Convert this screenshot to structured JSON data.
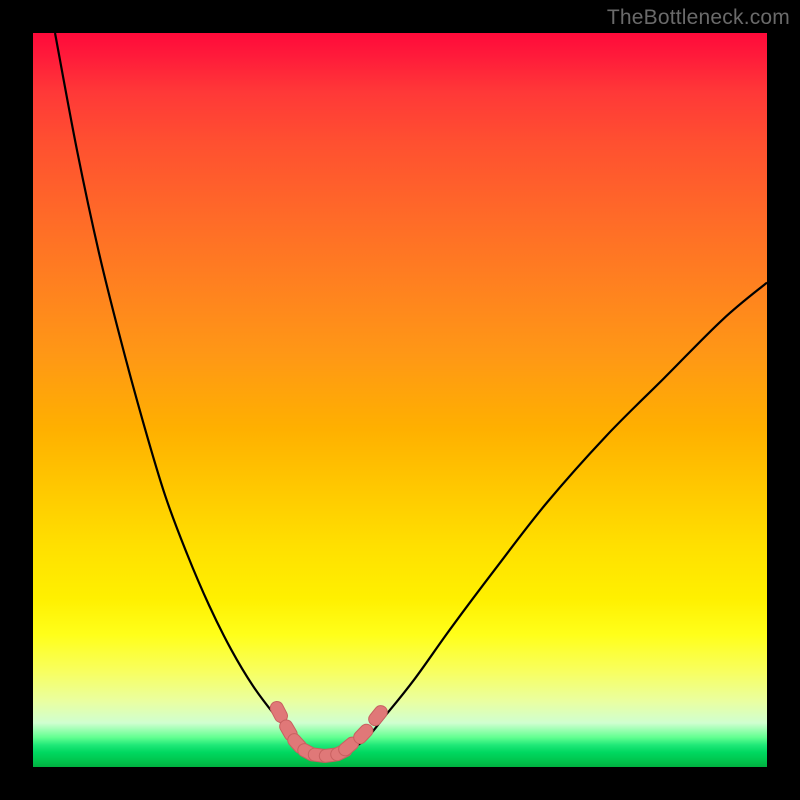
{
  "watermark": "TheBottleneck.com",
  "colors": {
    "frame": "#000000",
    "curve_stroke": "#000000",
    "marker_fill": "#e07878",
    "marker_stroke": "#c86060"
  },
  "chart_data": {
    "type": "line",
    "title": "",
    "xlabel": "",
    "ylabel": "",
    "xlim": [
      0,
      100
    ],
    "ylim": [
      0,
      100
    ],
    "series": [
      {
        "name": "left-curve",
        "x": [
          3,
          6,
          9,
          12,
          15,
          18,
          21,
          24,
          27,
          30,
          33,
          36,
          37.5
        ],
        "y": [
          100,
          84,
          70,
          58,
          47,
          37,
          29,
          22,
          16,
          11,
          7,
          3.5,
          2
        ]
      },
      {
        "name": "right-curve",
        "x": [
          42,
          45,
          48,
          52,
          57,
          63,
          70,
          78,
          86,
          94,
          100
        ],
        "y": [
          2,
          3.5,
          7,
          12,
          19,
          27,
          36,
          45,
          53,
          61,
          66
        ]
      },
      {
        "name": "valley-floor",
        "x": [
          37.5,
          38.5,
          40,
          41,
          42
        ],
        "y": [
          2,
          1.6,
          1.5,
          1.6,
          2
        ]
      }
    ],
    "markers": [
      {
        "x": 33.5,
        "y": 7.5
      },
      {
        "x": 34.8,
        "y": 5.0
      },
      {
        "x": 36.0,
        "y": 3.2
      },
      {
        "x": 37.5,
        "y": 2.0
      },
      {
        "x": 39.0,
        "y": 1.6
      },
      {
        "x": 40.5,
        "y": 1.6
      },
      {
        "x": 42.0,
        "y": 2.0
      },
      {
        "x": 43.0,
        "y": 2.8
      },
      {
        "x": 45.0,
        "y": 4.5
      },
      {
        "x": 47.0,
        "y": 7.0
      }
    ],
    "annotations": []
  }
}
